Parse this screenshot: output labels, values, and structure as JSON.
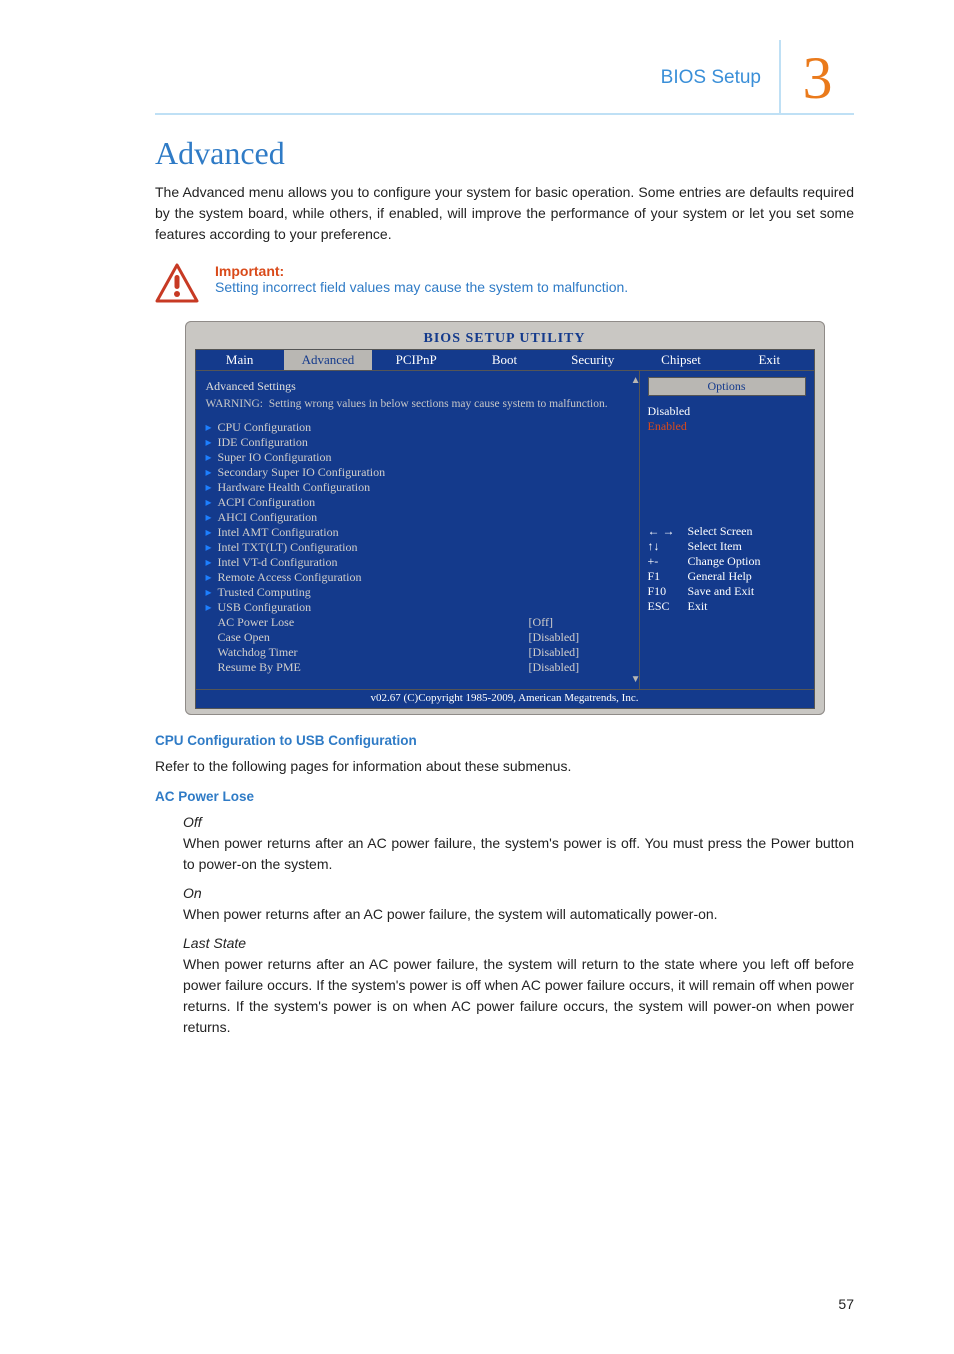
{
  "header": {
    "section": "BIOS Setup",
    "chapter": "3"
  },
  "h1": "Advanced",
  "intro": "The Advanced menu allows you to configure your system for basic operation. Some entries are defaults required by the system board, while others, if enabled, will improve the performance of your system or let you set some features according to your preference.",
  "important": {
    "label": "Important:",
    "text": "Setting incorrect field values may cause the system to malfunction."
  },
  "bios": {
    "title": "BIOS SETUP UTILITY",
    "tabs": [
      "Main",
      "Advanced",
      "PCIPnP",
      "Boot",
      "Security",
      "Chipset",
      "Exit"
    ],
    "active_tab_index": 1,
    "panel_heading": "Advanced Settings",
    "warning": "WARNING:  Setting wrong values in below sections may cause system to malfunction.",
    "items": [
      {
        "label": "CPU Configuration",
        "submenu": true
      },
      {
        "label": "IDE Configuration",
        "submenu": true
      },
      {
        "label": "Super IO Configuration",
        "submenu": true
      },
      {
        "label": "Secondary Super IO Configuration",
        "submenu": true
      },
      {
        "label": "Hardware Health Configuration",
        "submenu": true
      },
      {
        "label": "ACPI Configuration",
        "submenu": true
      },
      {
        "label": "AHCI Configuration",
        "submenu": true
      },
      {
        "label": "Intel AMT Configuration",
        "submenu": true
      },
      {
        "label": "Intel TXT(LT) Configuration",
        "submenu": true
      },
      {
        "label": "Intel VT-d Configuration",
        "submenu": true
      },
      {
        "label": "Remote Access Configuration",
        "submenu": true
      },
      {
        "label": "Trusted Computing",
        "submenu": true
      },
      {
        "label": "USB Configuration",
        "submenu": true
      },
      {
        "label": "AC Power Lose",
        "submenu": false,
        "value": "[Off]"
      },
      {
        "label": "Case Open",
        "submenu": false,
        "value": "[Disabled]"
      },
      {
        "label": "Watchdog Timer",
        "submenu": false,
        "value": "[Disabled]"
      },
      {
        "label": "Resume By PME",
        "submenu": false,
        "value": "[Disabled]"
      }
    ],
    "side": {
      "options_heading": "Options",
      "opt_disabled": "Disabled",
      "opt_enabled": "Enabled",
      "help": [
        {
          "key": "← →",
          "label": "Select Screen"
        },
        {
          "key": "↑↓",
          "label": "Select Item"
        },
        {
          "key": "+-",
          "label": "Change Option"
        },
        {
          "key": "F1",
          "label": "General Help"
        },
        {
          "key": "F10",
          "label": "Save and Exit"
        },
        {
          "key": "ESC",
          "label": "Exit"
        }
      ]
    },
    "footer": "v02.67 (C)Copyright 1985-2009, American Megatrends, Inc."
  },
  "sec1": {
    "heading": "CPU Configuration to USB Configuration",
    "text": "Refer to the following pages for information about these submenus."
  },
  "sec2": {
    "heading": "AC Power Lose",
    "off_label": "Off",
    "off_text": "When power returns after an AC power failure, the system's power is off. You must press the Power button to power-on the system.",
    "on_label": "On",
    "on_text": "When power returns after an AC power failure, the system will automatically power-on.",
    "last_label": "Last State",
    "last_text": "When power returns after an AC power failure, the system will return to the state where you left off before power failure occurs. If the system's power is off when AC power failure occurs, it will remain off when power returns. If the system's power is on when AC power failure occurs, the system will power-on when power returns."
  },
  "page_number": "57"
}
